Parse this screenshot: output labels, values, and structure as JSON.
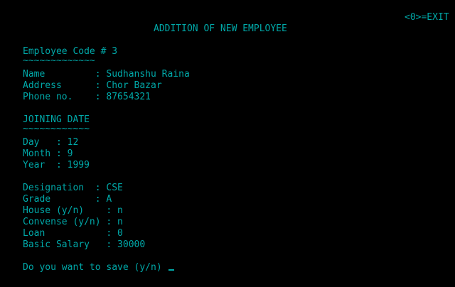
{
  "header": {
    "exit_hint": "<0>=EXIT",
    "title": "ADDITION OF NEW EMPLOYEE"
  },
  "employee": {
    "code_line": "Employee Code # 3",
    "code_underline": "~~~~~~~~~~~~~",
    "name_line": "Name         : Sudhanshu Raina",
    "address_line": "Address      : Chor Bazar",
    "phone_line": "Phone no.    : 87654321"
  },
  "joining": {
    "heading": "JOINING DATE",
    "heading_underline": "~~~~~~~~~~~~",
    "day_line": "Day   : 12",
    "month_line": "Month : 9",
    "year_line": "Year  : 1999"
  },
  "job": {
    "designation_line": "Designation  : CSE",
    "grade_line": "Grade        : A",
    "house_line": "House (y/n)    : n",
    "convense_line": "Convense (y/n) : n",
    "loan_line": "Loan           : 0",
    "salary_line": "Basic Salary   : 30000"
  },
  "prompt": {
    "save_question": "Do you want to save (y/n) "
  },
  "colors": {
    "text": "#00a8a8",
    "background": "#000000"
  }
}
